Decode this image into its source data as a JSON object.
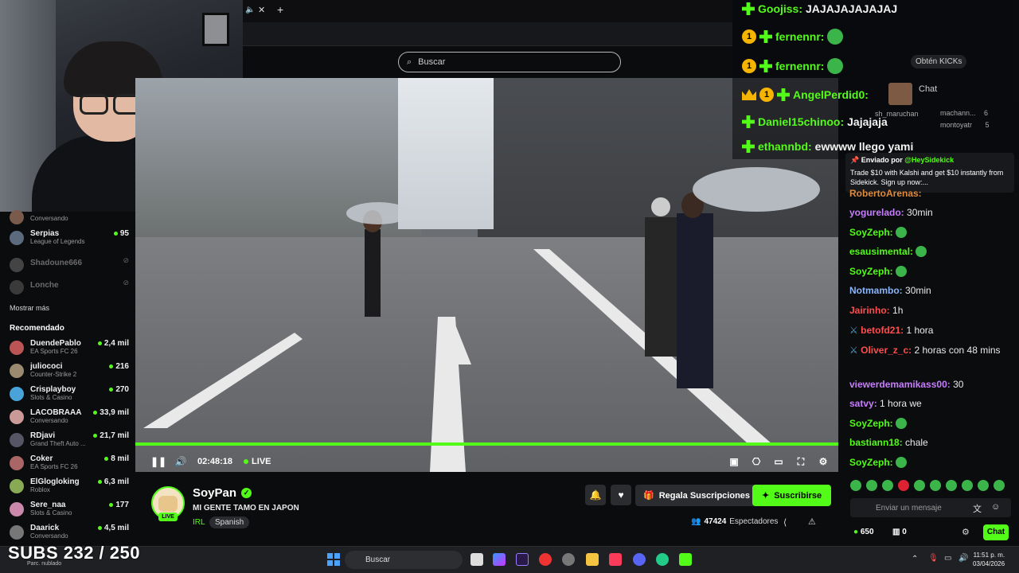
{
  "browser": {
    "search_placeholder": "Buscar"
  },
  "sidebar": {
    "followed": [
      {
        "name": "Conversando",
        "category": "",
        "count": ""
      },
      {
        "name": "Serpias",
        "category": "League of Legends",
        "count": "95"
      },
      {
        "name": "Shadoune666",
        "category": "",
        "count": ""
      },
      {
        "name": "Lonche",
        "category": "",
        "count": ""
      }
    ],
    "show_more": "Mostrar más",
    "recommended_title": "Recomendado",
    "recommended": [
      {
        "name": "DuendePablo",
        "category": "EA Sports FC 26",
        "count": "2,4 mil"
      },
      {
        "name": "juliococi",
        "category": "Counter-Strike 2",
        "count": "216"
      },
      {
        "name": "Crisplayboy",
        "category": "Slots & Casino",
        "count": "270"
      },
      {
        "name": "LACOBRAAA",
        "category": "Conversando",
        "count": "33,9 mil"
      },
      {
        "name": "RDjavi",
        "category": "Grand Theft Auto ...",
        "count": "21,7 mil"
      },
      {
        "name": "Coker",
        "category": "EA Sports FC 26",
        "count": "8 mil"
      },
      {
        "name": "ElGlogloking",
        "category": "Roblox",
        "count": "6,3 mil"
      },
      {
        "name": "Sere_naa",
        "category": "Slots & Casino",
        "count": "177"
      },
      {
        "name": "Daarick",
        "category": "Conversando",
        "count": "4,5 mil"
      }
    ]
  },
  "player": {
    "time": "02:48:18",
    "live": "LIVE"
  },
  "stream": {
    "channel": "SoyPan",
    "title": "MI GENTE TAMO EN JAPON",
    "category": "IRL",
    "tag": "Spanish",
    "live_badge": "LIVE",
    "gift_label": "Regala Suscripciones",
    "subscribe_label": "Suscribirse",
    "viewers": "47424",
    "viewers_label": "Espectadores"
  },
  "overlay_chat": [
    {
      "user": "Goojiss:",
      "msg": "JAJAJAJAJAJAJ"
    },
    {
      "user": "fernennr:",
      "msg": ""
    },
    {
      "user": "fernennr:",
      "msg": ""
    },
    {
      "user": "AngelPerdid0:",
      "msg": ""
    },
    {
      "user": "Daniel15chinoo:",
      "msg": "Jajajaja"
    },
    {
      "user": "ethannbd:",
      "msg": "ewwww llego yami"
    }
  ],
  "kick_header": {
    "get_kicks": "Obtén KICKs",
    "chat_label": "Chat"
  },
  "chat_leaders": [
    {
      "name": "sh_maruchan",
      "value": ""
    },
    {
      "name": "machann...",
      "value": "6"
    },
    {
      "name": "montoyatr",
      "value": "5"
    }
  ],
  "pinned": {
    "header": "Enviado por",
    "by": "@HeySidekick",
    "text": "Trade $10 with Kalshi and get $10 instantly from Sidekick. Sign up now:..."
  },
  "chat": [
    {
      "user": "RobertoArenas:",
      "msg": "",
      "color": "#e08a3c"
    },
    {
      "user": "yogurelado:",
      "msg": "30min",
      "color": "#c77dff"
    },
    {
      "user": "SoyZeph:",
      "msg": "",
      "color": "#53fc18"
    },
    {
      "user": "esausimental:",
      "msg": "",
      "color": "#53fc18"
    },
    {
      "user": "SoyZeph:",
      "msg": "",
      "color": "#53fc18"
    },
    {
      "user": "Notmambo:",
      "msg": "30min",
      "color": "#8ab4f8"
    },
    {
      "user": "Jairinho:",
      "msg": "1h",
      "color": "#ff4d4d"
    },
    {
      "user": "betofd21:",
      "msg": "1 hora",
      "color": "#ff4d4d"
    },
    {
      "user": "Oliver_z_c:",
      "msg": "2 horas con 48 mins",
      "color": "#ff4d4d"
    },
    {
      "user": "viewerdemamikass00:",
      "msg": "30",
      "color": "#c77dff"
    },
    {
      "user": "satvy:",
      "msg": "1 hora we",
      "color": "#c77dff"
    },
    {
      "user": "SoyZeph:",
      "msg": "",
      "color": "#53fc18"
    },
    {
      "user": "bastiann18:",
      "msg": "chale",
      "color": "#53fc18"
    },
    {
      "user": "SoyZeph:",
      "msg": "",
      "color": "#53fc18"
    }
  ],
  "chat_input": {
    "placeholder": "Enviar un mensaje",
    "points": "650",
    "count": "0",
    "button": "Chat"
  },
  "taskbar": {
    "search": "Buscar",
    "time": "11:51 p. m.",
    "date": "03/04/2026",
    "weather": "Parc. nublado"
  },
  "overlay_subs": "SUBS 232 / 250",
  "colors": {
    "accent": "#53fc18",
    "bg": "#0b0c0e"
  }
}
